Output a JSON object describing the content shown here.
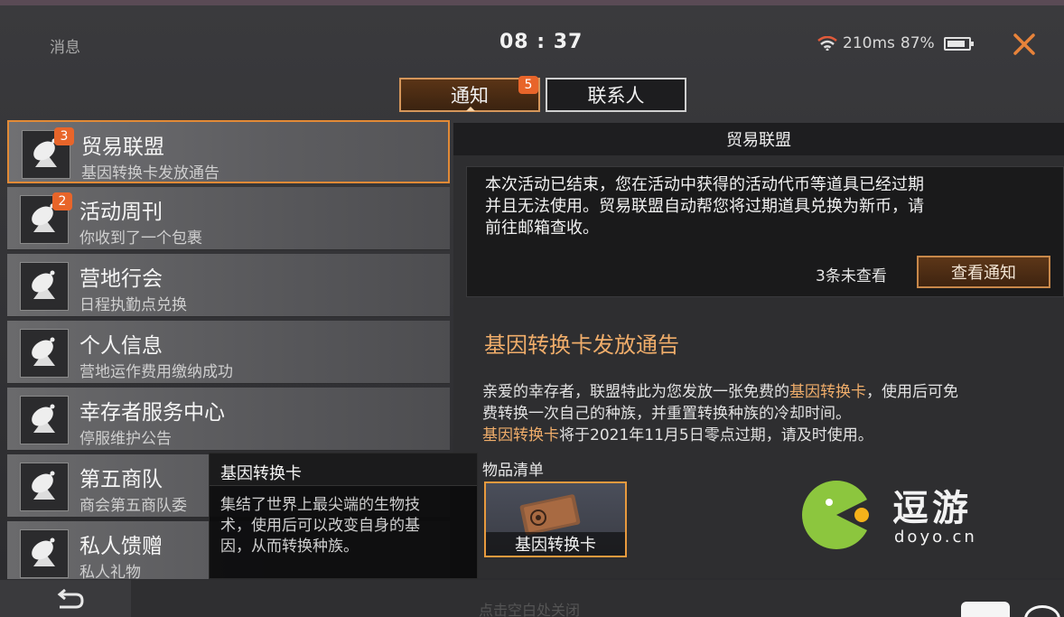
{
  "topbar": {
    "title": "消息",
    "clock": "08 : 37",
    "ping": "210ms",
    "battery": "87%"
  },
  "tabs": [
    {
      "label": "通知",
      "badge": "5",
      "active": true
    },
    {
      "label": "联系人",
      "active": false
    }
  ],
  "list": [
    {
      "title": "贸易联盟",
      "subtitle": "基因转换卡发放通告",
      "badge": "3",
      "selected": true
    },
    {
      "title": "活动周刊",
      "subtitle": "你收到了一个包裹",
      "badge": "2"
    },
    {
      "title": "营地行会",
      "subtitle": "日程执勤点兑换"
    },
    {
      "title": "个人信息",
      "subtitle": "营地运作费用缴纳成功"
    },
    {
      "title": "幸存者服务中心",
      "subtitle": "停服维护公告"
    },
    {
      "title": "第五商队",
      "subtitle": "商会第五商队委"
    },
    {
      "title": "私人馈赠",
      "subtitle": "私人礼物"
    }
  ],
  "detail": {
    "header": "贸易联盟",
    "notice_line1": "本次活动已结束，您在活动中获得的活动代币等道具已经过期",
    "notice_line2": "并且无法使用。贸易联盟自动帮您将过期道具兑换为新币，请",
    "notice_line3": "前往邮箱查收。",
    "unread": "3条未查看",
    "view_button": "查看通知",
    "article_title": "基因转换卡发放通告",
    "p1_a": "亲爱的幸存者，联盟特此为您发放一张免费的",
    "p1_hl": "基因转换卡",
    "p1_b": "，使用后可免",
    "p1_c": "费转换一次自己的种族，并重置转换种族的冷却时间。",
    "p2_hl": "基因转换卡",
    "p2_b": "将于2021年11月5日零点过期，请及时使用。",
    "items_label": "物品清单",
    "item_name": "基因转换卡"
  },
  "tooltip": {
    "title": "基因转换卡",
    "line1": "集结了世界上最尖端的生物技",
    "line2": "术，使用后可以改变自身的基",
    "line3": "因，从而转换种族。"
  },
  "watermark": {
    "text": "逗游",
    "url": "doyo.cn"
  },
  "bottom": {
    "hint": "点击空白处关闭"
  },
  "colors": {
    "accent": "#e8652a",
    "highlight": "#f0ad6a",
    "button_border": "#c8884a"
  }
}
